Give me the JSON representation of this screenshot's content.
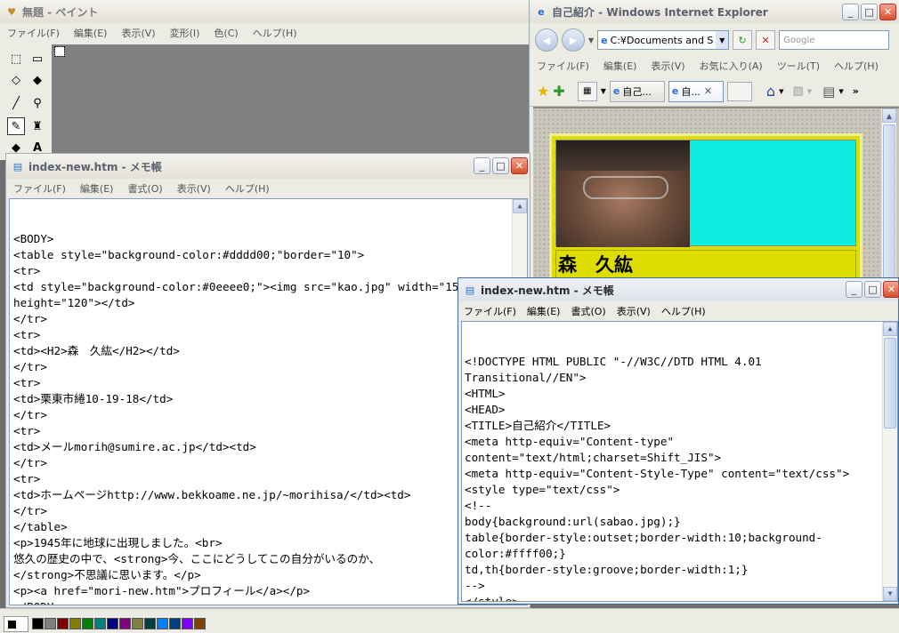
{
  "paint": {
    "title": "無題 - ペイント",
    "menu": [
      "ファイル(F)",
      "編集(E)",
      "表示(V)",
      "変形(I)",
      "色(C)",
      "ヘルプ(H)"
    ],
    "tools": [
      {
        "name": "free-select-icon",
        "glyph": "⬚"
      },
      {
        "name": "rect-select-icon",
        "glyph": "▭"
      },
      {
        "name": "eraser-icon",
        "glyph": "◇"
      },
      {
        "name": "fill-bucket-icon",
        "glyph": "◆"
      },
      {
        "name": "eyedropper-icon",
        "glyph": "╱"
      },
      {
        "name": "magnifier-icon",
        "glyph": "⚲"
      },
      {
        "name": "pencil-icon",
        "glyph": "✎"
      },
      {
        "name": "brush-icon",
        "glyph": "♜"
      },
      {
        "name": "airbrush-icon",
        "glyph": "◆"
      },
      {
        "name": "text-icon",
        "glyph": "A"
      }
    ],
    "palette": [
      "#000000",
      "#808080",
      "#800000",
      "#808000",
      "#008000",
      "#008080",
      "#000080",
      "#800080",
      "#808040",
      "#004040",
      "#0080ff",
      "#004080",
      "#8000ff",
      "#804000"
    ]
  },
  "ie": {
    "title": "自己紹介 - Windows Internet Explorer",
    "address": "C:¥Documents and S",
    "search_placeholder": "Google",
    "menu": [
      "ファイル(F)",
      "編集(E)",
      "表示(V)",
      "お気に入り(A)",
      "ツール(T)",
      "ヘルプ(H)"
    ],
    "tabs": [
      "自己...",
      "自..."
    ],
    "more": "»",
    "page_name": "森　久紘"
  },
  "notepad_back": {
    "title": "index-new.htm - メモ帳",
    "menu": [
      "ファイル(F)",
      "編集(E)",
      "書式(O)",
      "表示(V)",
      "ヘルプ(H)"
    ],
    "text": "<BODY>\n<table style=\"background-color:#dddd00;\"border=\"10\">\n<tr>\n<td style=\"background-color:#0eeee0;\"><img src=\"kao.jpg\" width=\"150\"\nheight=\"120\"></td>\n</tr>\n<tr>\n<td><H2>森　久紘</H2></td>\n</tr>\n<tr>\n<td>栗東市綣10-19-18</td>\n</tr>\n<tr>\n<td>メールmorih@sumire.ac.jp</td><td>\n</tr>\n<tr>\n<td>ホームページhttp://www.bekkoame.ne.jp/~morihisa/</td><td>\n</tr>\n</table>\n<p>1945年に地球に出現しました。<br>\n悠久の歴史の中で、<strong>今、ここにどうしてこの自分がいるのか、\n</strong>不思議に思います。</p>\n<p><a href=\"mori-new.htm\">プロフィール</a></p>\n</BODY>\n</HTML>"
  },
  "notepad_front": {
    "title": "index-new.htm - メモ帳",
    "menu": [
      "ファイル(F)",
      "編集(E)",
      "書式(O)",
      "表示(V)",
      "ヘルプ(H)"
    ],
    "text": "<!DOCTYPE HTML PUBLIC \"-//W3C//DTD HTML 4.01\nTransitional//EN\">\n<HTML>\n<HEAD>\n<TITLE>自己紹介</TITLE>\n<meta http-equiv=\"Content-type\"\ncontent=\"text/html;charset=Shift_JIS\">\n<meta http-equiv=\"Content-Style-Type\" content=\"text/css\">\n<style type=\"text/css\">\n<!--\nbody{background:url(sabao.jpg);}\ntable{border-style:outset;border-width:10;background-\ncolor:#ffff00;}\ntd,th{border-style:groove;border-width:1;}\n-->\n</style>\n</HEAD>"
  }
}
